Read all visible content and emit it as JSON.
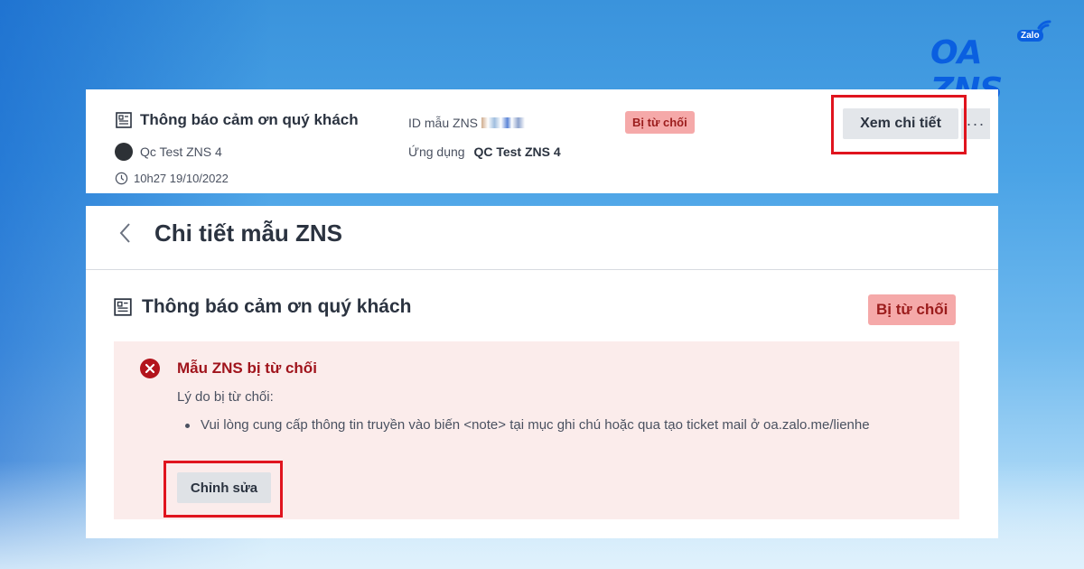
{
  "brand": {
    "logo_text": "OA ZNS",
    "logo_badge": "Zalo",
    "color": "#0a5fe0"
  },
  "template_card": {
    "title": "Thông báo cảm ơn quý khách",
    "owner": "Qc Test ZNS 4",
    "timestamp": "10h27 19/10/2022",
    "id_label": "ID mẫu ZNS",
    "app_label": "Ứng dụng",
    "app_value": "QC Test ZNS 4",
    "status_badge": "Bị từ chối",
    "view_button": "Xem chi tiết",
    "more_button": "···"
  },
  "detail": {
    "page_title": "Chi tiết mẫu ZNS",
    "template_title": "Thông báo cảm ơn quý khách",
    "status_badge": "Bị từ chối",
    "rejection": {
      "title": "Mẫu ZNS bị từ chối",
      "reason_label": "Lý do bị từ chối:",
      "reasons": [
        "Vui lòng cung cấp thông tin truyền vào biến <note> tại mục ghi chú hoặc qua tạo ticket mail ở oa.zalo.me/lienhe"
      ],
      "edit_button": "Chỉnh sửa"
    }
  },
  "colors": {
    "badge_bg": "#f5a9a9",
    "badge_text": "#9b1c1c",
    "reject_bg": "#fbeceb",
    "highlight_frame": "#e0141e"
  }
}
